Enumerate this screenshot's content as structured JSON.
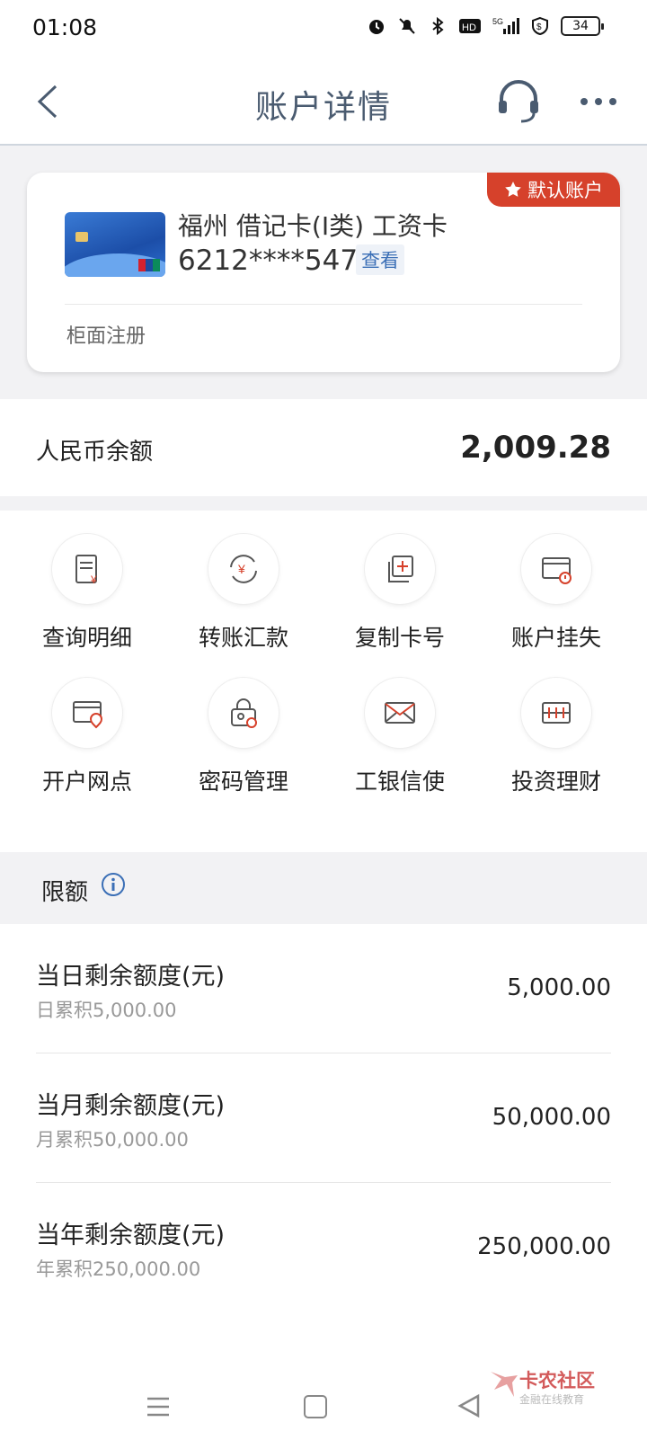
{
  "status_bar": {
    "time": "01:08",
    "battery": "34",
    "icons": [
      "alarm-icon",
      "mute-icon",
      "bluetooth-icon",
      "hd-icon",
      "signal-5g-icon",
      "shield-icon"
    ]
  },
  "nav": {
    "title": "账户详情"
  },
  "card": {
    "badge": "默认账户",
    "name": "福州 借记卡(I类) 工资卡",
    "number": "6212****5477",
    "view_label": "查看",
    "note": "柜面注册"
  },
  "balance": {
    "label": "人民币余额",
    "value": "2,009.28"
  },
  "actions": [
    {
      "label": "查询明细",
      "icon": "statement-icon"
    },
    {
      "label": "转账汇款",
      "icon": "transfer-icon"
    },
    {
      "label": "复制卡号",
      "icon": "copy-icon"
    },
    {
      "label": "账户挂失",
      "icon": "report-loss-icon"
    },
    {
      "label": "开户网点",
      "icon": "branch-location-icon"
    },
    {
      "label": "密码管理",
      "icon": "password-icon"
    },
    {
      "label": "工银信使",
      "icon": "message-icon"
    },
    {
      "label": "投资理财",
      "icon": "investment-icon"
    }
  ],
  "limits": {
    "title": "限额",
    "rows": [
      {
        "label": "当日剩余额度(元)",
        "sub": "日累积5,000.00",
        "value": "5,000.00"
      },
      {
        "label": "当月剩余额度(元)",
        "sub": "月累积50,000.00",
        "value": "50,000.00"
      },
      {
        "label": "当年剩余额度(元)",
        "sub": "年累积250,000.00",
        "value": "250,000.00"
      }
    ]
  },
  "watermark": {
    "title": "卡农社区",
    "subtitle": "金融在线教育"
  },
  "colors": {
    "accent": "#d6412b",
    "nav_title": "#4a5b70",
    "link": "#3b6fb6"
  }
}
